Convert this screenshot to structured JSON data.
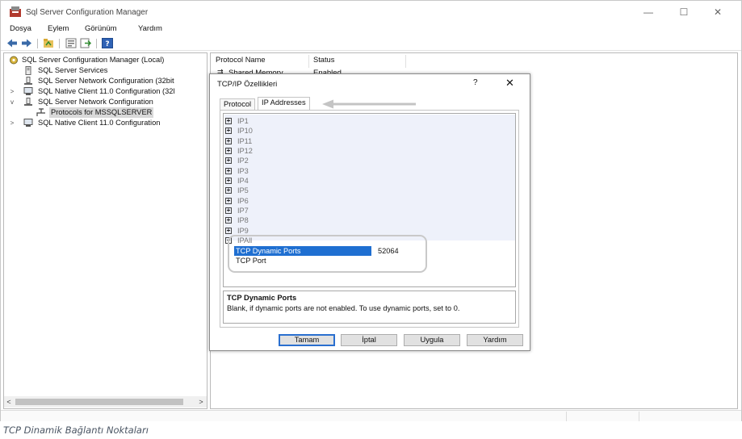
{
  "window": {
    "title": "Sql Server Configuration Manager",
    "controls": {
      "minimize": "—",
      "maximize": "☐",
      "close": "✕"
    }
  },
  "menu": [
    "Dosya",
    "Eylem",
    "Görünüm",
    "Yardım"
  ],
  "tree": [
    {
      "label": "SQL Server Configuration Manager (Local)",
      "arrow": "",
      "icon": "config-manager-icon"
    },
    {
      "label": "SQL Server Services",
      "arrow": "",
      "icon": "services-icon"
    },
    {
      "label": "SQL Server Network Configuration (32bit",
      "arrow": "",
      "icon": "network-icon"
    },
    {
      "label": "SQL Native Client 11.0 Configuration (32l",
      "arrow": ">",
      "icon": "client-icon"
    },
    {
      "label": "SQL Server Network Configuration",
      "arrow": "v",
      "icon": "network-icon"
    },
    {
      "label": "Protocols for MSSQLSERVER",
      "arrow": "",
      "icon": "protocols-icon"
    },
    {
      "label": "SQL Native Client 11.0 Configuration",
      "arrow": ">",
      "icon": "client-icon"
    }
  ],
  "list": {
    "columns": [
      "Protocol Name",
      "Status"
    ],
    "rows": [
      {
        "name": "Shared Memory",
        "status": "Enabled"
      }
    ]
  },
  "dialog": {
    "title": "TCP/IP Özellikleri",
    "help": "?",
    "close": "✕",
    "tabs": [
      "Protocol",
      "IP Addresses"
    ],
    "active_tab": "IP Addresses",
    "ip_groups": [
      "IP1",
      "IP10",
      "IP11",
      "IP12",
      "IP2",
      "IP3",
      "IP4",
      "IP5",
      "IP6",
      "IP7",
      "IP8",
      "IP9"
    ],
    "ipall": {
      "label": "IPAll",
      "properties": [
        {
          "name": "TCP Dynamic Ports",
          "value": "52064",
          "selected": true
        },
        {
          "name": "TCP Port",
          "value": "",
          "selected": false
        }
      ]
    },
    "description": {
      "title": "TCP Dynamic Ports",
      "text": "Blank, if dynamic ports are not enabled. To use dynamic ports, set to 0."
    },
    "buttons": [
      "Tamam",
      "İptal",
      "Uygula",
      "Yardım"
    ]
  },
  "caption": "TCP Dinamik Bağlantı Noktaları",
  "colors": {
    "selection": "#1f6fd1",
    "accent_border": "#2a6fcf",
    "caption": "#4a5563"
  }
}
